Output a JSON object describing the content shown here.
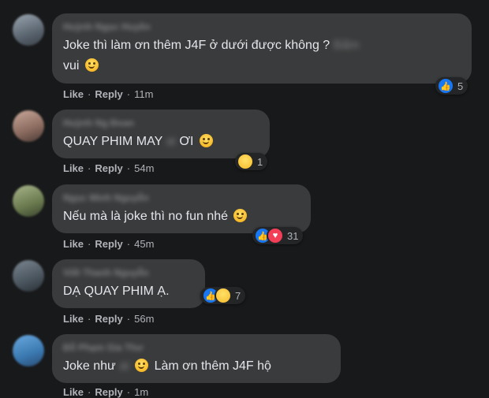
{
  "comments": [
    {
      "author": "Huỳnh Ngọc Huyền",
      "text": "Joke thì làm ơn thêm J4F ở dưới được không ?",
      "text_hidden": "Bấm",
      "text_line2": "vui",
      "actions": {
        "like": "Like",
        "reply": "Reply",
        "time": "11m"
      },
      "reaction_count": "5"
    },
    {
      "author": "Huỳnh Ng Đoan",
      "text": "QUAY PHIM MAY",
      "text_hidden": "ai",
      "text_after": "ƠI",
      "actions": {
        "like": "Like",
        "reply": "Reply",
        "time": "54m"
      },
      "reaction_count": "1"
    },
    {
      "author": "Ngọc Minh Nguyễn",
      "text": "Nếu mà là joke thì no fun nhé",
      "actions": {
        "like": "Like",
        "reply": "Reply",
        "time": "45m"
      },
      "reaction_count": "31"
    },
    {
      "author": "Viết Thanh Nguyễn",
      "text": "DẠ QUAY PHIM Ạ.",
      "actions": {
        "like": "Like",
        "reply": "Reply",
        "time": "56m"
      },
      "reaction_count": "7"
    },
    {
      "author": "Đỗ Phạm Gia Thư",
      "text": "Joke như",
      "text_hidden": "ai",
      "text_after": "Làm ơn thêm J4F hộ",
      "actions": {
        "like": "Like",
        "reply": "Reply",
        "time": "1m"
      }
    }
  ],
  "colors": {
    "background": "#18191a",
    "bubble": "#3a3b3c",
    "like": "#1877f2",
    "love": "#f33e58"
  }
}
